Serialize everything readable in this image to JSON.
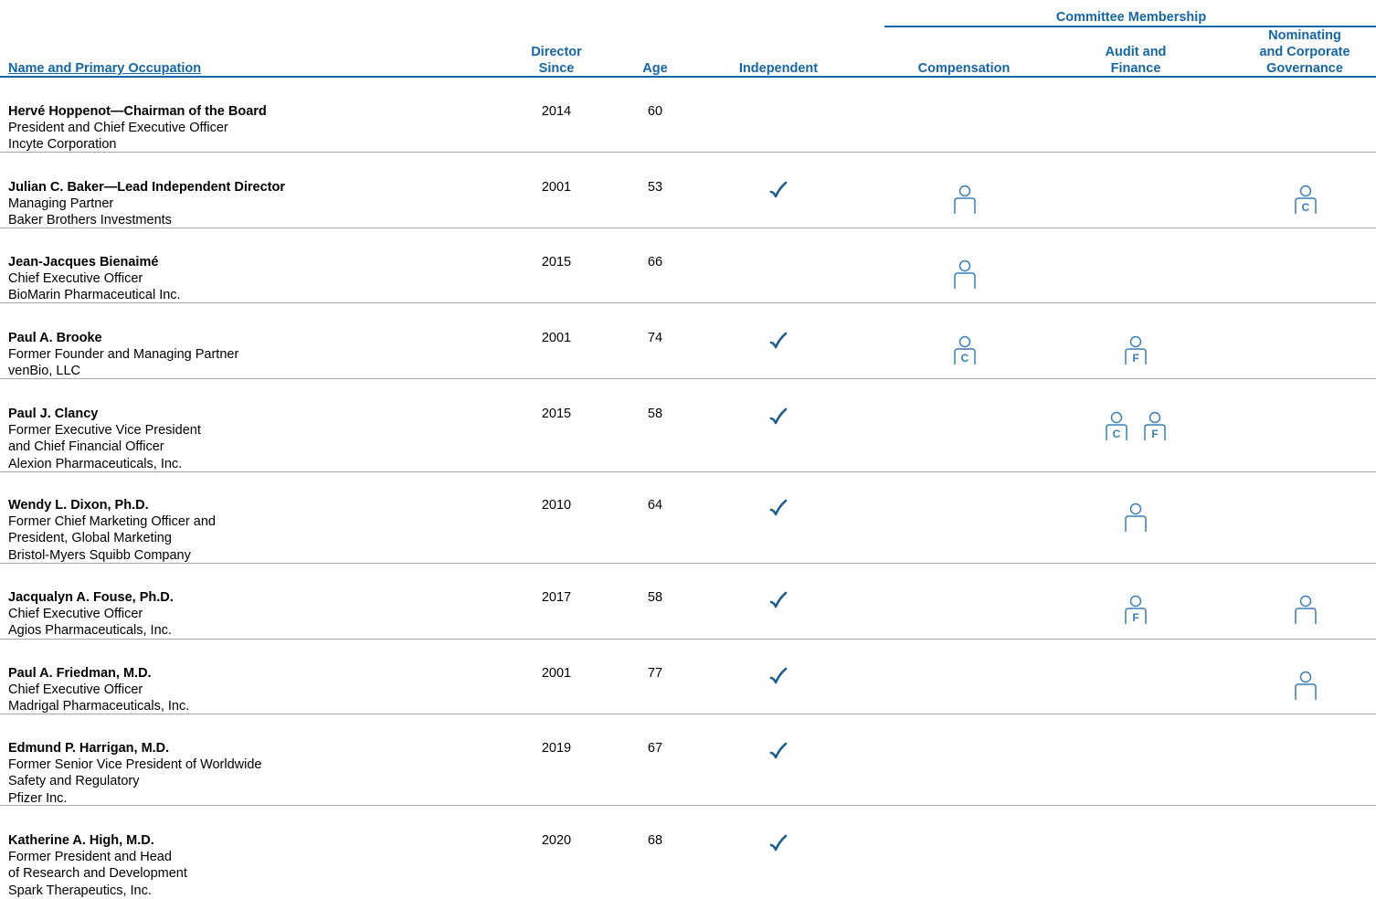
{
  "header": {
    "committee_membership": "Committee Membership",
    "name_col": "Name and Primary Occupation",
    "director_since_line1": "Director",
    "director_since_line2": "Since",
    "age": "Age",
    "independent": "Independent",
    "compensation": "Compensation",
    "audit_line1": "Audit and",
    "audit_line2": "Finance",
    "nominating_line1": "Nominating",
    "nominating_line2": "and Corporate",
    "nominating_line3": "Governance"
  },
  "colors": {
    "header_blue": "#1566a8",
    "icon_blue": "#3a7fb5",
    "check_blue": "#1f5d8a",
    "separator": "#a8a8a8"
  },
  "legend_icons": {
    "member": "member-icon",
    "chair": "chair-icon (C)",
    "financial_expert": "financial-expert-icon (F)",
    "independent": "checkmark-icon"
  },
  "directors": [
    {
      "name": "Hervé Hoppenot—Chairman of the Board",
      "occupation": [
        "President and Chief Executive Officer",
        "Incyte Corporation"
      ],
      "since": "2014",
      "age": "60",
      "independent": false,
      "compensation": "",
      "audit": [],
      "nominating": ""
    },
    {
      "name": "Julian C. Baker—Lead Independent Director",
      "occupation": [
        "Managing Partner",
        "Baker Brothers Investments"
      ],
      "since": "2001",
      "age": "53",
      "independent": true,
      "compensation": "member",
      "audit": [],
      "nominating": "chair"
    },
    {
      "name": "Jean-Jacques Bienaimé",
      "occupation": [
        "Chief Executive Officer",
        "BioMarin Pharmaceutical Inc."
      ],
      "since": "2015",
      "age": "66",
      "independent": false,
      "compensation": "member",
      "audit": [],
      "nominating": ""
    },
    {
      "name": "Paul A. Brooke",
      "occupation": [
        "Former Founder and Managing Partner",
        "venBio, LLC"
      ],
      "since": "2001",
      "age": "74",
      "independent": true,
      "compensation": "chair",
      "audit": [
        "financial"
      ],
      "nominating": ""
    },
    {
      "name": "Paul J. Clancy",
      "occupation": [
        "Former Executive Vice President",
        "and Chief Financial Officer",
        "Alexion Pharmaceuticals, Inc."
      ],
      "since": "2015",
      "age": "58",
      "independent": true,
      "compensation": "",
      "audit": [
        "chair",
        "financial"
      ],
      "nominating": ""
    },
    {
      "name": "Wendy L. Dixon, Ph.D.",
      "occupation": [
        "Former Chief Marketing Officer and",
        "President, Global Marketing",
        "Bristol-Myers Squibb Company"
      ],
      "since": "2010",
      "age": "64",
      "independent": true,
      "compensation": "",
      "audit": [
        "member"
      ],
      "nominating": ""
    },
    {
      "name": "Jacqualyn A. Fouse, Ph.D.",
      "occupation": [
        "Chief Executive Officer",
        "Agios Pharmaceuticals, Inc."
      ],
      "since": "2017",
      "age": "58",
      "independent": true,
      "compensation": "",
      "audit": [
        "financial"
      ],
      "nominating": "member"
    },
    {
      "name": "Paul A. Friedman, M.D.",
      "occupation": [
        "Chief Executive Officer",
        "Madrigal Pharmaceuticals, Inc."
      ],
      "since": "2001",
      "age": "77",
      "independent": true,
      "compensation": "",
      "audit": [],
      "nominating": "member"
    },
    {
      "name": "Edmund P. Harrigan, M.D.",
      "occupation": [
        "Former Senior Vice President of Worldwide",
        "Safety and Regulatory",
        "Pfizer Inc."
      ],
      "since": "2019",
      "age": "67",
      "independent": true,
      "compensation": "",
      "audit": [],
      "nominating": ""
    },
    {
      "name": "Katherine A. High, M.D.",
      "occupation": [
        "Former President and Head",
        "of Research and Development",
        "Spark Therapeutics, Inc."
      ],
      "since": "2020",
      "age": "68",
      "independent": true,
      "compensation": "",
      "audit": [],
      "nominating": ""
    }
  ]
}
